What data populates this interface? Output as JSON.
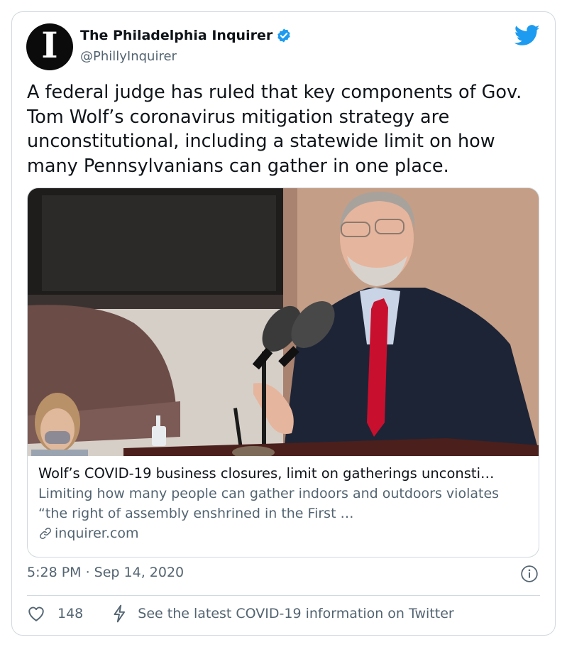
{
  "author": {
    "display_name": "The Philadelphia Inquirer",
    "handle": "@PhillyInquirer",
    "avatar_glyph": "I",
    "verified": true
  },
  "tweet": {
    "text": "A federal judge has ruled that key components of Gov. Tom Wolf’s coronavirus mitigation strategy are unconstitutional, including a statewide limit on how many Pennsylvanians can gather in one place."
  },
  "link_card": {
    "title": "Wolf’s COVID-19 business closures, limit on gatherings unconsti…",
    "description": "Limiting how many people can gather indoors and outdoors violates “the right of assembly enshrined in the First …",
    "domain": "inquirer.com",
    "image_icon": "photo-governor-at-podium"
  },
  "timestamp": "5:28 PM · Sep 14, 2020",
  "actions": {
    "like_count": "148",
    "covid_info": "See the latest COVID-19 information on Twitter"
  },
  "colors": {
    "twitter_blue": "#1d9bf0",
    "secondary_text": "#536471",
    "border": "#cfd9de",
    "tie_red": "#c8102e"
  },
  "icons": [
    "verified-badge-icon",
    "twitter-bird-icon",
    "link-icon",
    "info-icon",
    "heart-icon",
    "lightning-icon"
  ]
}
